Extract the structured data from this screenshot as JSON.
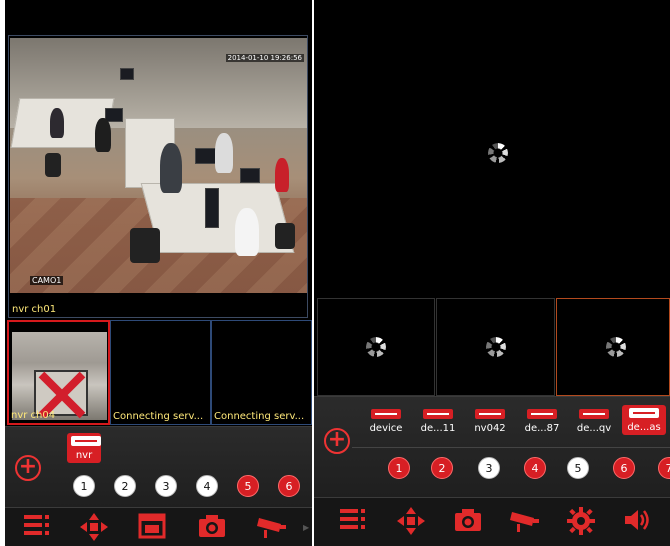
{
  "left": {
    "main_video": {
      "timestamp": "2014-01-10 19:26:56",
      "camera_name": "CAMO1",
      "channel_label": "nvr ch01"
    },
    "thumbnails": [
      {
        "label": "nvr ch04",
        "state": "video",
        "selected": true
      },
      {
        "label": "Connecting serv...",
        "state": "connecting"
      },
      {
        "label": "Connecting serv...",
        "state": "connecting"
      }
    ],
    "device_bar": {
      "add_icon": "plus-circle-icon",
      "devices": [
        {
          "label": "nvr",
          "active": true
        }
      ]
    },
    "channels": [
      {
        "n": "1",
        "style": "white"
      },
      {
        "n": "2",
        "style": "white"
      },
      {
        "n": "3",
        "style": "white"
      },
      {
        "n": "4",
        "style": "white"
      },
      {
        "n": "5",
        "style": "red"
      },
      {
        "n": "6",
        "style": "red"
      }
    ],
    "toolbar": [
      "menu-icon",
      "ptz-arrows-icon",
      "record-icon",
      "camera-icon",
      "cctv-camera-icon"
    ]
  },
  "right": {
    "devices": [
      {
        "label": "device",
        "active": false
      },
      {
        "label": "de...11",
        "active": false
      },
      {
        "label": "nv042",
        "active": false
      },
      {
        "label": "de...87",
        "active": false
      },
      {
        "label": "de...qv",
        "active": false
      },
      {
        "label": "de...as",
        "active": true
      }
    ],
    "channels": [
      {
        "n": "1",
        "style": "red"
      },
      {
        "n": "2",
        "style": "red"
      },
      {
        "n": "3",
        "style": "white"
      },
      {
        "n": "4",
        "style": "red"
      },
      {
        "n": "5",
        "style": "white"
      },
      {
        "n": "6",
        "style": "red"
      },
      {
        "n": "7",
        "style": "red"
      }
    ],
    "toolbar": [
      "menu-icon",
      "ptz-arrows-icon",
      "camera-icon",
      "cctv-camera-icon",
      "settings-icon",
      "volume-icon"
    ]
  },
  "colors": {
    "accent": "#d71f24",
    "label": "#ffe97a",
    "background": "#000000"
  }
}
